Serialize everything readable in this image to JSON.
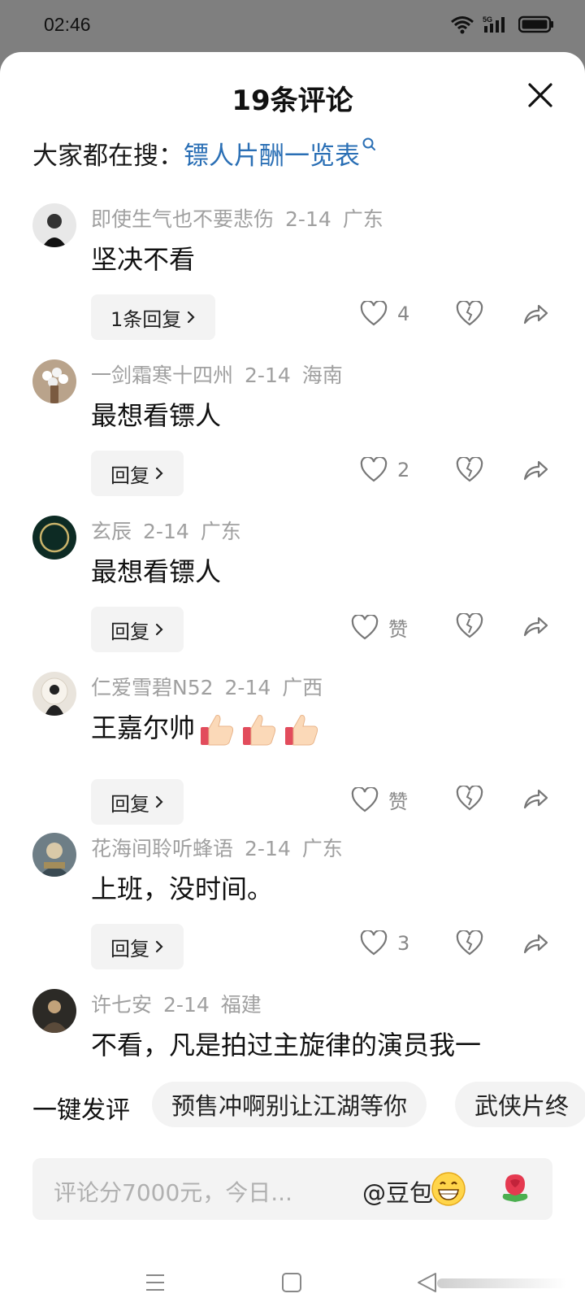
{
  "status_bar": {
    "time": "02:46",
    "icons": [
      "wifi-icon",
      "signal-5g-icon",
      "battery-icon"
    ],
    "network_label": "5G"
  },
  "sheet": {
    "title": "19条评论",
    "close_icon": "close-icon"
  },
  "search": {
    "prefix": "大家都在搜：",
    "link": "镖人片酬一览表"
  },
  "comments": [
    {
      "user": "即使生气也不要悲伤",
      "date": "2-14",
      "region": "广东",
      "text": "坚决不看",
      "reply_label": "1条回复",
      "likes": "4"
    },
    {
      "user": "一剑霜寒十四州",
      "date": "2-14",
      "region": "海南",
      "text": "最想看镖人",
      "reply_label": "回复",
      "likes": "2"
    },
    {
      "user": "玄辰",
      "date": "2-14",
      "region": "广东",
      "text": "最想看镖人",
      "reply_label": "回复",
      "likes": "赞"
    },
    {
      "user": "仁爱雪碧N52",
      "date": "2-14",
      "region": "广西",
      "text": "王嘉尔帅",
      "reply_label": "回复",
      "likes": "赞"
    },
    {
      "user": "花海间聆听蜂语",
      "date": "2-14",
      "region": "广东",
      "text": "上班，没时间。",
      "reply_label": "回复",
      "likes": "3"
    },
    {
      "user": "许七安",
      "date": "2-14",
      "region": "福建",
      "text": "不看，凡是拍过主旋律的演员我一"
    }
  ],
  "quick_comment": {
    "label": "一键发评",
    "chips": [
      "预售冲啊别让江湖等你",
      "武侠片终"
    ]
  },
  "input": {
    "placeholder": "评论分7000元，今日...",
    "mention": "@豆包",
    "emojis": [
      "grin-emoji-icon",
      "rose-emoji-icon"
    ]
  },
  "nav": {
    "icons": [
      "menu-icon",
      "home-icon",
      "back-icon"
    ]
  },
  "colors": {
    "link": "#2a6fb5",
    "meta_text": "#a0a0a0",
    "chip_bg": "#f3f3f3",
    "status_bg": "#7f7f7f"
  }
}
